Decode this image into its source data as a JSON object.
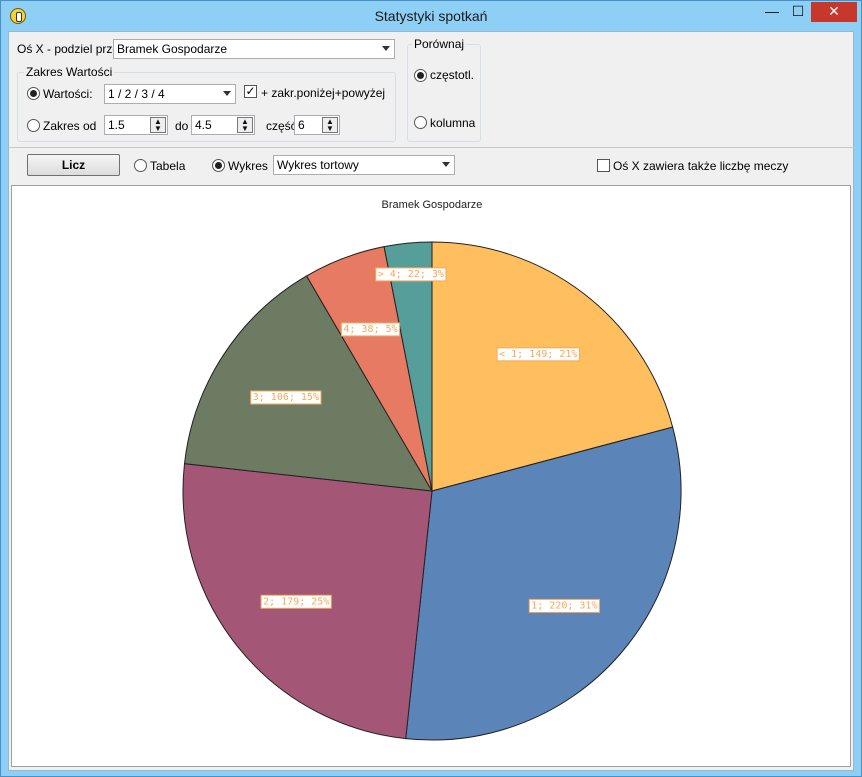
{
  "window": {
    "title": "Statystyki spotkań",
    "min_glyph": "—",
    "max_glyph": "☐",
    "close_glyph": "✕"
  },
  "controls": {
    "axis_label": "Oś X - podziel przez",
    "axis_value": "Bramek Gospodarze",
    "range_group_title": "Zakres Wartości",
    "values_radio_label": "Wartości:",
    "values_combo": "1 / 2 / 3 / 4",
    "extend_checkbox_label": "+ zakr.poniżej+powyżej",
    "extend_checked": true,
    "range_radio_label": "Zakres od",
    "range_from": "1.5",
    "range_to_label": "do",
    "range_to": "4.5",
    "parts_label": "część",
    "parts_value": "6",
    "compare_group_title": "Porównaj",
    "compare_freq_label": "częstotl.",
    "compare_column_label": "kolumna"
  },
  "toolbar": {
    "compute_button": "Licz",
    "table_radio": "Tabela",
    "chart_radio": "Wykres",
    "chart_type": "Wykres tortowy",
    "include_matches_label": "Oś X zawiera także liczbę meczy"
  },
  "chart_data": {
    "type": "pie",
    "title": "Bramek Gospodarze",
    "slices": [
      {
        "label": "< 1",
        "count": 149,
        "percent": 21,
        "color": "#ffbf5f",
        "text": "< 1; 149; 21%"
      },
      {
        "label": "1",
        "count": 220,
        "percent": 31,
        "color": "#5b85b8",
        "text": "1; 220; 31%"
      },
      {
        "label": "2",
        "count": 179,
        "percent": 25,
        "color": "#a45676",
        "text": "2; 179; 25%"
      },
      {
        "label": "3",
        "count": 106,
        "percent": 15,
        "color": "#6d7b62",
        "text": "3; 106; 15%"
      },
      {
        "label": "4",
        "count": 38,
        "percent": 5,
        "color": "#e67a62",
        "text": "4; 38; 5%"
      },
      {
        "label": "> 4",
        "count": 22,
        "percent": 3,
        "color": "#569e9a",
        "text": "> 4; 22; 3%"
      }
    ],
    "label_color": "#f6a85a"
  }
}
